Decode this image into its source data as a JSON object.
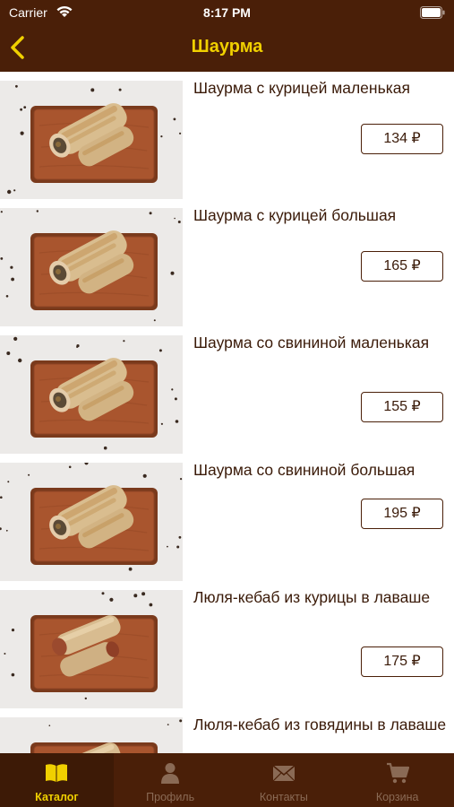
{
  "status_bar": {
    "carrier": "Carrier",
    "time": "8:17 PM"
  },
  "nav": {
    "title": "Шаурма"
  },
  "products": [
    {
      "name": "Шаурма с курицей маленькая",
      "price": "134 ₽"
    },
    {
      "name": "Шаурма с курицей большая",
      "price": "165 ₽"
    },
    {
      "name": "Шаурма со свининой маленькая",
      "price": "155 ₽"
    },
    {
      "name": "Шаурма со свининой большая",
      "price": "195 ₽"
    },
    {
      "name": "Люля-кебаб из курицы в лаваше",
      "price": "175 ₽"
    },
    {
      "name": "Люля-кебаб из говядины в лаваше",
      "price": ""
    }
  ],
  "tabs": [
    {
      "label": "Каталог",
      "icon": "book-icon",
      "active": true
    },
    {
      "label": "Профиль",
      "icon": "person-icon",
      "active": false
    },
    {
      "label": "Контакты",
      "icon": "envelope-icon",
      "active": false
    },
    {
      "label": "Корзина",
      "icon": "cart-icon",
      "active": false
    }
  ],
  "colors": {
    "brand": "#4a1f08",
    "accent": "#f0d000",
    "inactive": "#8a6a55"
  }
}
